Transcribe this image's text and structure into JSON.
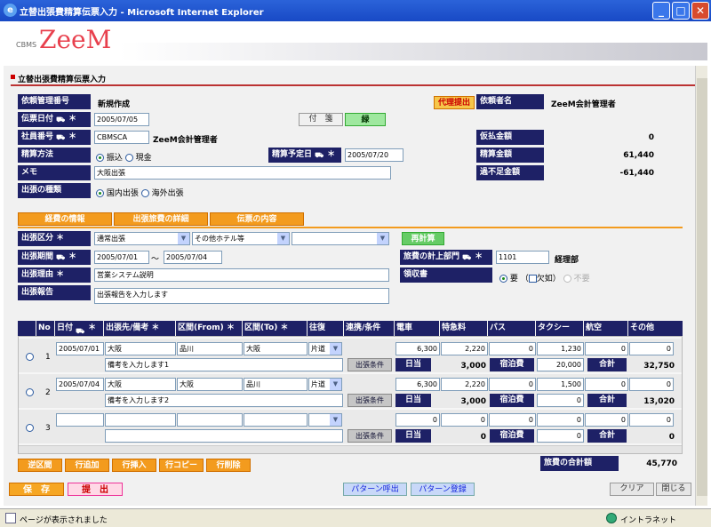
{
  "window": {
    "title": "立替出張費精算伝票入力 - Microsoft Internet Explorer",
    "min": "_",
    "max": "□",
    "close": "✕"
  },
  "logo": {
    "small": "CBMS",
    "big": "ZeeM"
  },
  "page": {
    "heading": "立替出張費精算伝票入力"
  },
  "form": {
    "req_no_label": "依頼管理番号",
    "req_no_value": "新規作成",
    "proxy_button": "代理提出",
    "requester_label": "依頼者名",
    "requester_value": "ZeeM会計管理者",
    "date_label": "伝票日付",
    "date_value": "2005/07/05",
    "fusen_button": "付　箋",
    "green_button": "緑",
    "emp_label": "社員番号",
    "emp_value": "CBMSCA",
    "emp_name": "ZeeM会計管理者",
    "adv_label": "仮払金額",
    "adv_value": "0",
    "method_label": "精算方法",
    "method_opt1": "振込",
    "method_opt2": "現金",
    "plan_label": "精算予定日",
    "plan_value": "2005/07/20",
    "settle_label": "精算金額",
    "settle_value": "61,440",
    "memo_label": "メモ",
    "memo_value": "大阪出張",
    "diff_label": "過不足金額",
    "diff_value": "-61,440",
    "kind_label": "出張の種類",
    "kind_opt1": "国内出張",
    "kind_opt2": "海外出張"
  },
  "tabs": {
    "t1": "経費の情報",
    "t2": "出張旅費の詳細",
    "t3": "伝票の内容"
  },
  "trip": {
    "type_label": "出張区分",
    "type_sel1": "通常出張",
    "type_sel2": "その他ホテル等",
    "type_sel3": "",
    "recalc": "再計算",
    "period_label": "出張期間",
    "period_from": "2005/07/01",
    "period_tilde": "～",
    "period_to": "2005/07/04",
    "dept_label": "旅費の計上部門",
    "dept_code": "1101",
    "dept_name": "経理部",
    "reason_label": "出張理由",
    "reason_value": "営業システム説明",
    "receipt_label": "領収書",
    "receipt_opt1": "要",
    "receipt_opt2_open": "（",
    "receipt_opt2": "欠如",
    "receipt_opt2_close": "）",
    "receipt_opt3": "不要",
    "report_label": "出張報告",
    "report_value": "出張報告を入力します"
  },
  "table": {
    "headers": {
      "no": "No",
      "date": "日付",
      "dest": "出張先/備考",
      "from": "区間(From)",
      "to": "区間(To)",
      "round": "往復",
      "cond": "連携/条件",
      "train": "電車",
      "express": "特急料",
      "bus": "バス",
      "taxi": "タクシー",
      "air": "航空",
      "other": "その他"
    },
    "cond_btn": "出張条件",
    "daily_label": "日当",
    "lodging_label": "宿泊費",
    "total_label": "合計",
    "rows": [
      {
        "no": "1",
        "date": "2005/07/01",
        "dest": "大阪",
        "from": "品川",
        "to": "大阪",
        "round": "片道",
        "train": "6,300",
        "express": "2,220",
        "bus": "0",
        "taxi": "1,230",
        "air": "0",
        "other": "0",
        "memo": "備考を入力します1",
        "daily": "3,000",
        "lodging": "20,000",
        "total": "32,750"
      },
      {
        "no": "2",
        "date": "2005/07/04",
        "dest": "大阪",
        "from": "大阪",
        "to": "品川",
        "round": "片道",
        "train": "6,300",
        "express": "2,220",
        "bus": "0",
        "taxi": "1,500",
        "air": "0",
        "other": "0",
        "memo": "備考を入力します2",
        "daily": "3,000",
        "lodging": "0",
        "total": "13,020"
      },
      {
        "no": "3",
        "date": "",
        "dest": "",
        "from": "",
        "to": "",
        "round": "",
        "train": "0",
        "express": "0",
        "bus": "0",
        "taxi": "0",
        "air": "0",
        "other": "0",
        "memo": "",
        "daily": "0",
        "lodging": "0",
        "total": "0"
      }
    ]
  },
  "row_actions": {
    "b1": "逆区間",
    "b2": "行追加",
    "b3": "行挿入",
    "b4": "行コピー",
    "b5": "行削除"
  },
  "sum": {
    "label": "旅費の合計額",
    "value": "45,770"
  },
  "footer": {
    "save": "保　存",
    "submit": "提　出",
    "pattern_call": "パターン呼出",
    "pattern_reg": "パターン登録",
    "clear": "クリア",
    "close": "閉じる"
  },
  "status": {
    "text": "ページが表示されました",
    "zone": "イントラネット"
  }
}
